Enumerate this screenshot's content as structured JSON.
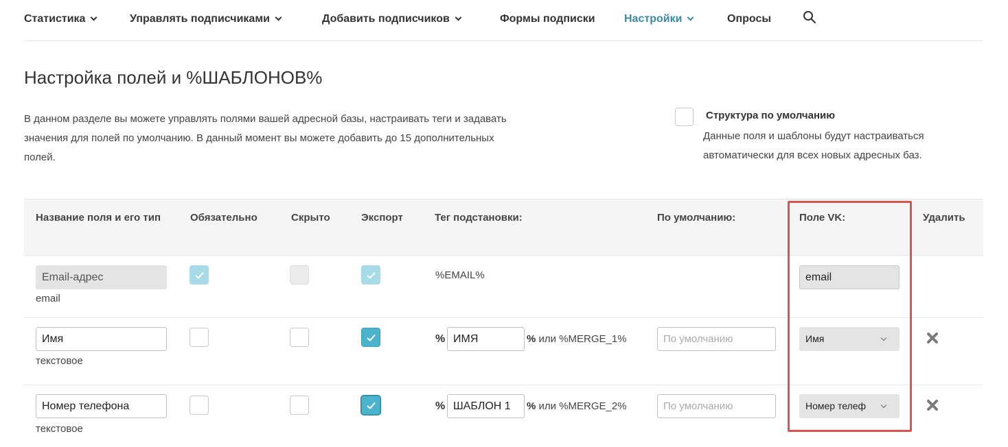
{
  "nav": {
    "items": [
      {
        "label": "Статистика",
        "dropdown": true
      },
      {
        "label": "Управлять подписчиками",
        "dropdown": true
      },
      {
        "label": "Добавить подписчиков",
        "dropdown": true
      },
      {
        "label": "Формы подписки",
        "dropdown": false
      },
      {
        "label": "Настройки",
        "dropdown": true,
        "active": true
      },
      {
        "label": "Опросы",
        "dropdown": false
      }
    ],
    "search_icon": "search-icon"
  },
  "page": {
    "title": "Настройка полей и %ШАБЛОНОВ%",
    "intro": "В данном разделе вы можете управлять полями вашей адресной базы, настраивать теги и задавать значения для полей по умолчанию. В данный момент вы можете добавить до 15 дополнительных полей.",
    "default_structure": {
      "title": "Структура по умолчанию",
      "description": "Данные поля и шаблоны будут настраиваться автоматически для всех новых адресных баз.",
      "checked": false
    }
  },
  "table": {
    "headers": {
      "name": "Название поля и его тип",
      "required": "Обязательно",
      "hidden": "Скрыто",
      "export": "Экспорт",
      "tag": "Тег подстановки:",
      "default": "По умолчанию:",
      "vk": "Поле VK:",
      "delete": "Удалить"
    },
    "rows": [
      {
        "name": "Email-адрес",
        "type": "email",
        "required": true,
        "hidden": false,
        "export": true,
        "locked": true,
        "tag_static": "%EMAIL%",
        "vk_value": "email"
      },
      {
        "name": "Имя",
        "type": "текстовое",
        "required": false,
        "hidden": false,
        "export": true,
        "tag_prefix": "%",
        "tag_value": "ИМЯ",
        "tag_suffix_bold": "%",
        "tag_suffix": " или %MERGE_1%",
        "default_placeholder": "По умолчанию",
        "vk_value": "Имя"
      },
      {
        "name": "Номер телефона",
        "type": "текстовое",
        "required": false,
        "hidden": false,
        "export": true,
        "tag_prefix": "%",
        "tag_value": "ШАБЛОН 1",
        "tag_suffix_bold": "%",
        "tag_suffix": " или %MERGE_2%",
        "default_placeholder": "По умолчанию",
        "vk_value": "Номер телеф"
      }
    ]
  },
  "colors": {
    "accent": "#3a8aa3",
    "checkbox_checked": "#4bb3cc",
    "highlight": "#d9534f"
  }
}
